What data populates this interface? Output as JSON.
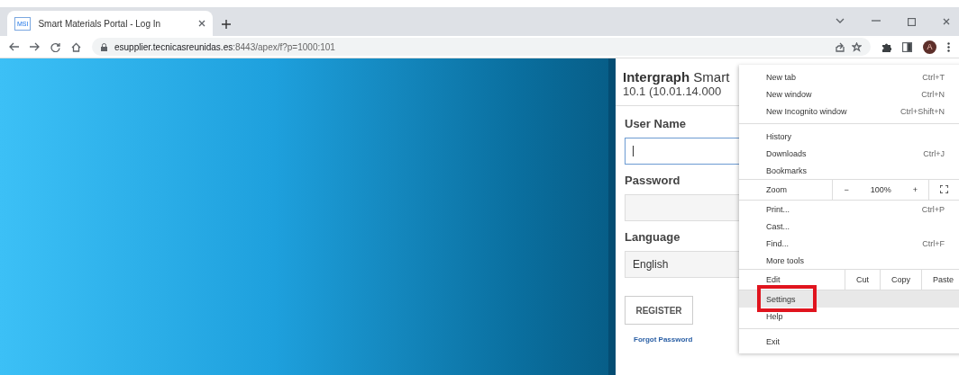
{
  "browser": {
    "tab": {
      "title": "Smart Materials Portal - Log In",
      "favicon": "MSI",
      "selected": true
    },
    "url": {
      "host": "esupplier.tecnicasreunidas.es",
      "rest": ":8443/apex/f?p=1000:101"
    },
    "avatar": "A"
  },
  "login": {
    "title": "**Intergraph** Smart",
    "version": "10.1 (10.01.14.000",
    "fields": [
      {
        "label": "User Name",
        "focused": true
      },
      {
        "label": "Password",
        "focused": false
      },
      {
        "label": "Language",
        "value": "English",
        "focused": false
      }
    ],
    "register": "REGISTER",
    "forgot": "Forgot Password"
  },
  "menu": {
    "items": [
      {
        "kind": "item",
        "label": "New tab",
        "shortcut": "Ctrl+T",
        "selected": false,
        "outlined": false
      },
      {
        "kind": "item",
        "label": "New window",
        "shortcut": "Ctrl+N",
        "selected": false,
        "outlined": false
      },
      {
        "kind": "item",
        "label": "New Incognito window",
        "shortcut": "Ctrl+Shift+N",
        "selected": false,
        "outlined": false
      },
      {
        "kind": "separator"
      },
      {
        "kind": "item",
        "label": "History",
        "selected": false,
        "outlined": false
      },
      {
        "kind": "item",
        "label": "Downloads",
        "shortcut": "Ctrl+J",
        "selected": false,
        "outlined": false
      },
      {
        "kind": "item",
        "label": "Bookmarks",
        "selected": false,
        "outlined": false
      },
      {
        "kind": "zoom",
        "label": "Zoom",
        "minus": "−",
        "value": "100%",
        "plus": "+"
      },
      {
        "kind": "item",
        "label": "Print...",
        "shortcut": "Ctrl+P",
        "selected": false,
        "outlined": false
      },
      {
        "kind": "item",
        "label": "Cast...",
        "selected": false,
        "outlined": false
      },
      {
        "kind": "item",
        "label": "Find...",
        "shortcut": "Ctrl+F",
        "selected": false,
        "outlined": false
      },
      {
        "kind": "item",
        "label": "More tools",
        "selected": false,
        "outlined": false
      },
      {
        "kind": "edit",
        "label": "Edit",
        "actions": [
          "Cut",
          "Copy",
          "Paste"
        ]
      },
      {
        "kind": "item",
        "label": "Settings",
        "selected": true,
        "outlined": true
      },
      {
        "kind": "item",
        "label": "Help",
        "selected": false,
        "outlined": false
      },
      {
        "kind": "separator"
      },
      {
        "kind": "item",
        "label": "Exit",
        "selected": false,
        "outlined": false
      }
    ]
  }
}
